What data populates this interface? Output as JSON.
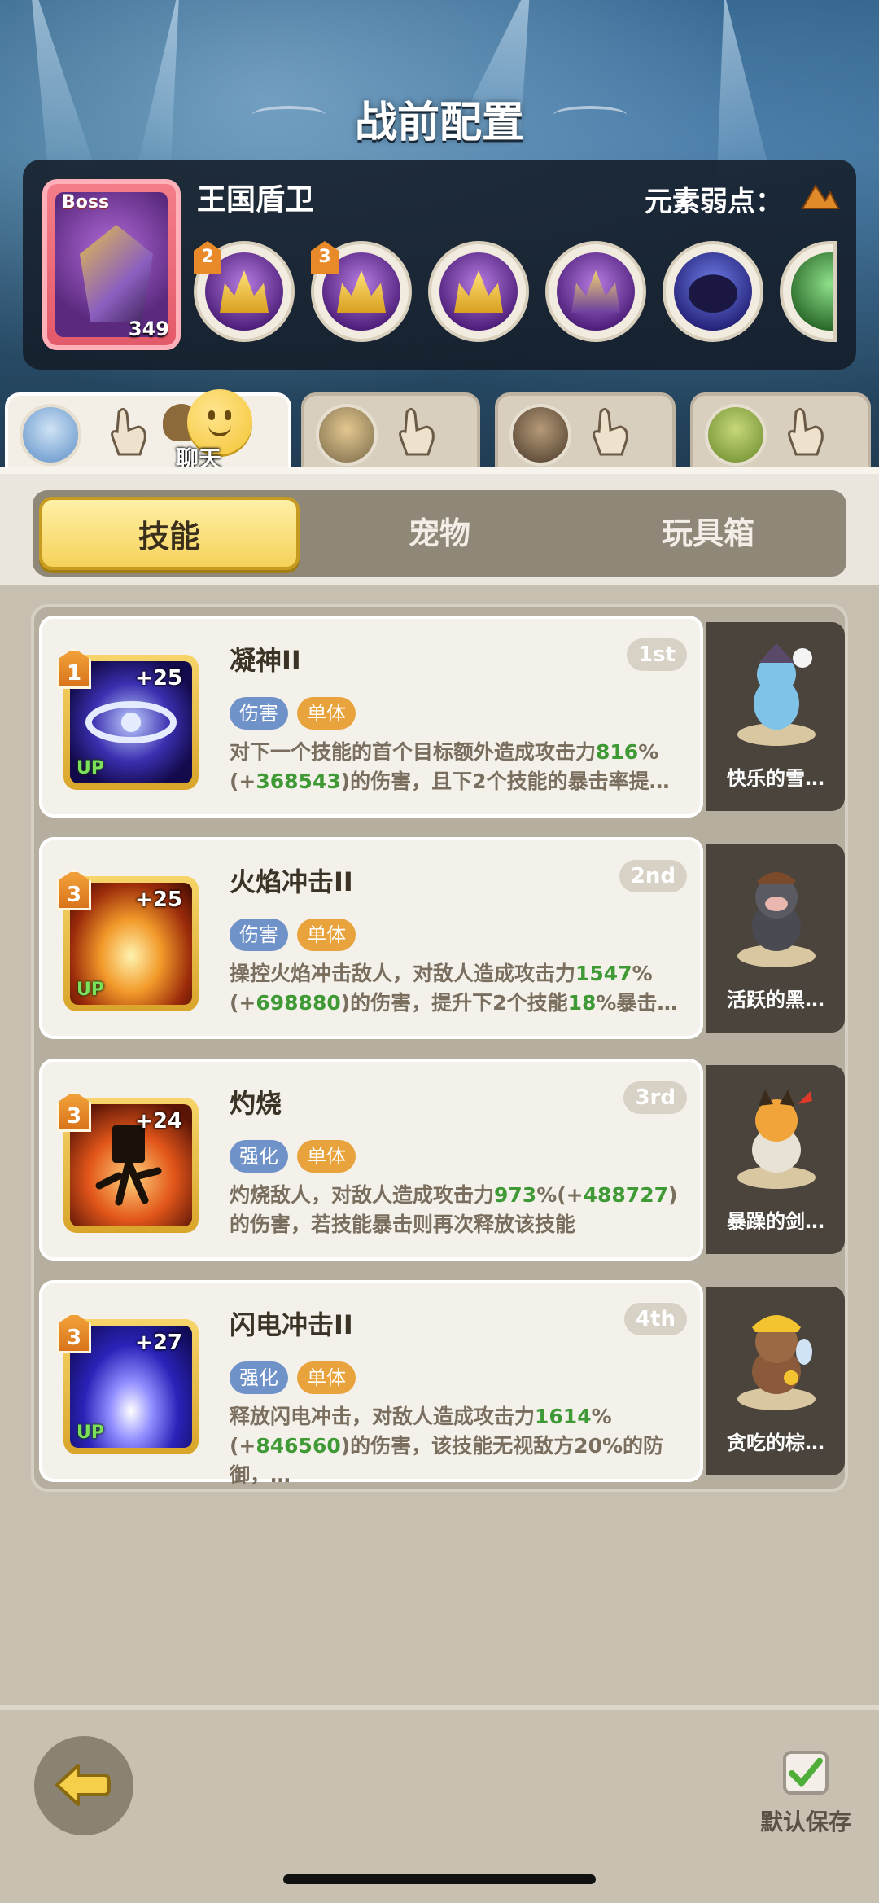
{
  "header": {
    "title": "战前配置",
    "boss": {
      "label": "Boss",
      "level": "349",
      "name": "王国盾卫",
      "element_weakness_label": "元素弱点："
    },
    "boss_skills": [
      {
        "badge": "2",
        "icon": "golden-gauntlet-icon"
      },
      {
        "badge": "3",
        "icon": "golden-crown-icon"
      },
      {
        "badge": "",
        "icon": "golden-crest-icon"
      },
      {
        "badge": "",
        "icon": "dark-knight-icon"
      },
      {
        "badge": "",
        "icon": "shadow-beast-icon"
      }
    ]
  },
  "hero_tabs": [
    {
      "id": "hero-1",
      "active": true
    },
    {
      "id": "hero-2",
      "active": false
    },
    {
      "id": "hero-3",
      "active": false
    },
    {
      "id": "hero-4",
      "active": false
    }
  ],
  "chat": {
    "label": "聊天"
  },
  "segments": {
    "skills": "技能",
    "pets": "宠物",
    "toybox": "玩具箱",
    "active": "skills"
  },
  "skills": [
    {
      "level": "1",
      "plus": "+25",
      "up": "UP",
      "name": "凝神II",
      "rank": "1st",
      "tags": [
        "伤害",
        "单体"
      ],
      "desc_parts": [
        {
          "t": "对下一个技能的首个目标额外造成攻击力"
        },
        {
          "t": "816",
          "hl": true
        },
        {
          "t": "%(+"
        },
        {
          "t": "368543",
          "hl": true
        },
        {
          "t": ")的伤害，且下2个技能的暴击率提…"
        }
      ],
      "pet": {
        "name": "快乐的雪…"
      }
    },
    {
      "level": "3",
      "plus": "+25",
      "up": "UP",
      "name": "火焰冲击II",
      "rank": "2nd",
      "tags": [
        "伤害",
        "单体"
      ],
      "desc_parts": [
        {
          "t": "操控火焰冲击敌人，对敌人造成攻击力"
        },
        {
          "t": "1547",
          "hl": true
        },
        {
          "t": "%(+"
        },
        {
          "t": "698880",
          "hl": true
        },
        {
          "t": ")的伤害，提升下2个技能"
        },
        {
          "t": "18",
          "hl": true
        },
        {
          "t": "%暴击…"
        }
      ],
      "pet": {
        "name": "活跃的黑…"
      }
    },
    {
      "level": "3",
      "plus": "+24",
      "up": "",
      "name": "灼烧",
      "rank": "3rd",
      "tags": [
        "强化",
        "单体"
      ],
      "desc_parts": [
        {
          "t": "灼烧敌人，对敌人造成攻击力"
        },
        {
          "t": "973",
          "hl": true
        },
        {
          "t": "%(+"
        },
        {
          "t": "488727",
          "hl": true
        },
        {
          "t": ")的伤害，若技能暴击则再次释放该技能"
        }
      ],
      "pet": {
        "name": "暴躁的剑…"
      }
    },
    {
      "level": "3",
      "plus": "+27",
      "up": "UP",
      "name": "闪电冲击II",
      "rank": "4th",
      "tags": [
        "强化",
        "单体"
      ],
      "desc_parts": [
        {
          "t": "释放闪电冲击，对敌人造成攻击力"
        },
        {
          "t": "1614",
          "hl": true
        },
        {
          "t": "%(+"
        },
        {
          "t": "846560",
          "hl": true
        },
        {
          "t": ")的伤害，该技能无视敌方20%的防御，…"
        }
      ],
      "pet": {
        "name": "贪吃的棕…"
      }
    }
  ],
  "footer": {
    "save_label": "默认保存"
  }
}
